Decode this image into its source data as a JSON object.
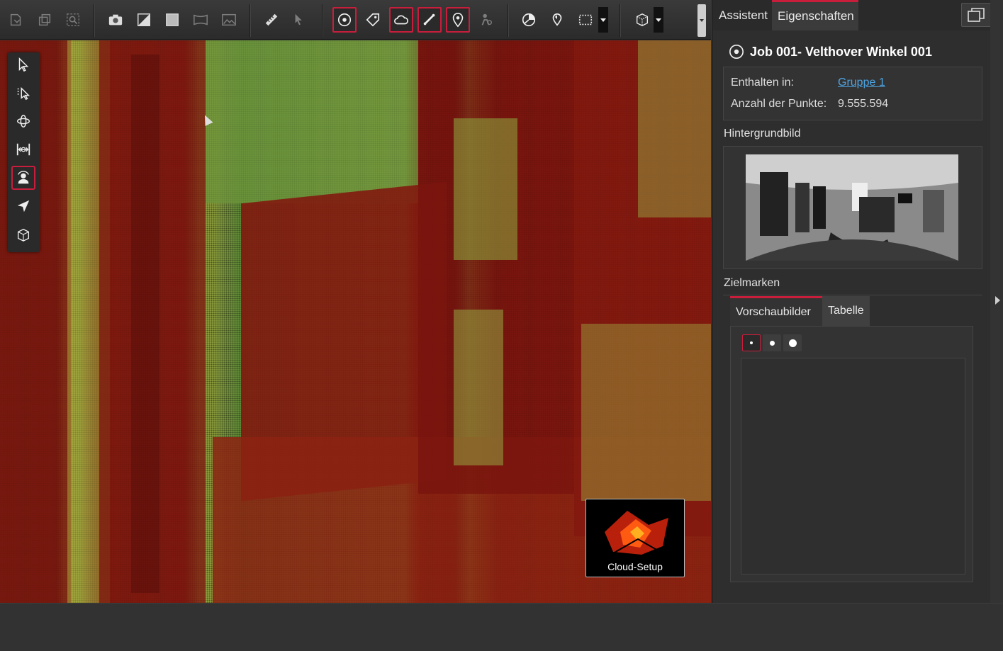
{
  "toolbar": {
    "tools_group1": [
      "import-icon",
      "duplicate-icon",
      "zoom-extent-icon"
    ],
    "tools_group2": [
      "camera-icon",
      "contrast-icon",
      "square-icon",
      "panorama-icon",
      "image-icon"
    ],
    "tools_group3": [
      "ruler-icon",
      "measure-pointer-icon"
    ],
    "tools_group4": [
      "target-icon",
      "tag-icon",
      "cloud-icon",
      "scale-bar-icon",
      "location-pin-icon",
      "walk-icon"
    ],
    "tools_group5": [
      "pie-chart-icon",
      "pin-color-icon",
      "selection-box-icon",
      "cube-view-icon"
    ]
  },
  "palette": [
    "select-arrow-icon",
    "select-multi-icon",
    "orbit-icon",
    "fit-width-icon",
    "person-view-icon",
    "fly-icon",
    "box-3d-icon"
  ],
  "panel": {
    "tab_assistant": "Assistent",
    "tab_properties": "Eigenschaften",
    "job_title": "Job 001- Velthover Winkel 001",
    "contained_label": "Enthalten in:",
    "contained_value": "Gruppe 1",
    "points_label": "Anzahl der Punkte:",
    "points_value": "9.555.594",
    "background_title": "Hintergrundbild",
    "targets_title": "Zielmarken",
    "subtab_previews": "Vorschaubilder",
    "subtab_table": "Tabelle"
  },
  "viewport": {
    "cloud_setup_label": "Cloud-Setup"
  },
  "colors": {
    "accent": "#c81e3c",
    "link": "#4da3e0",
    "pointcloud_red": "#8b1d12",
    "pointcloud_green": "#8fa040"
  }
}
